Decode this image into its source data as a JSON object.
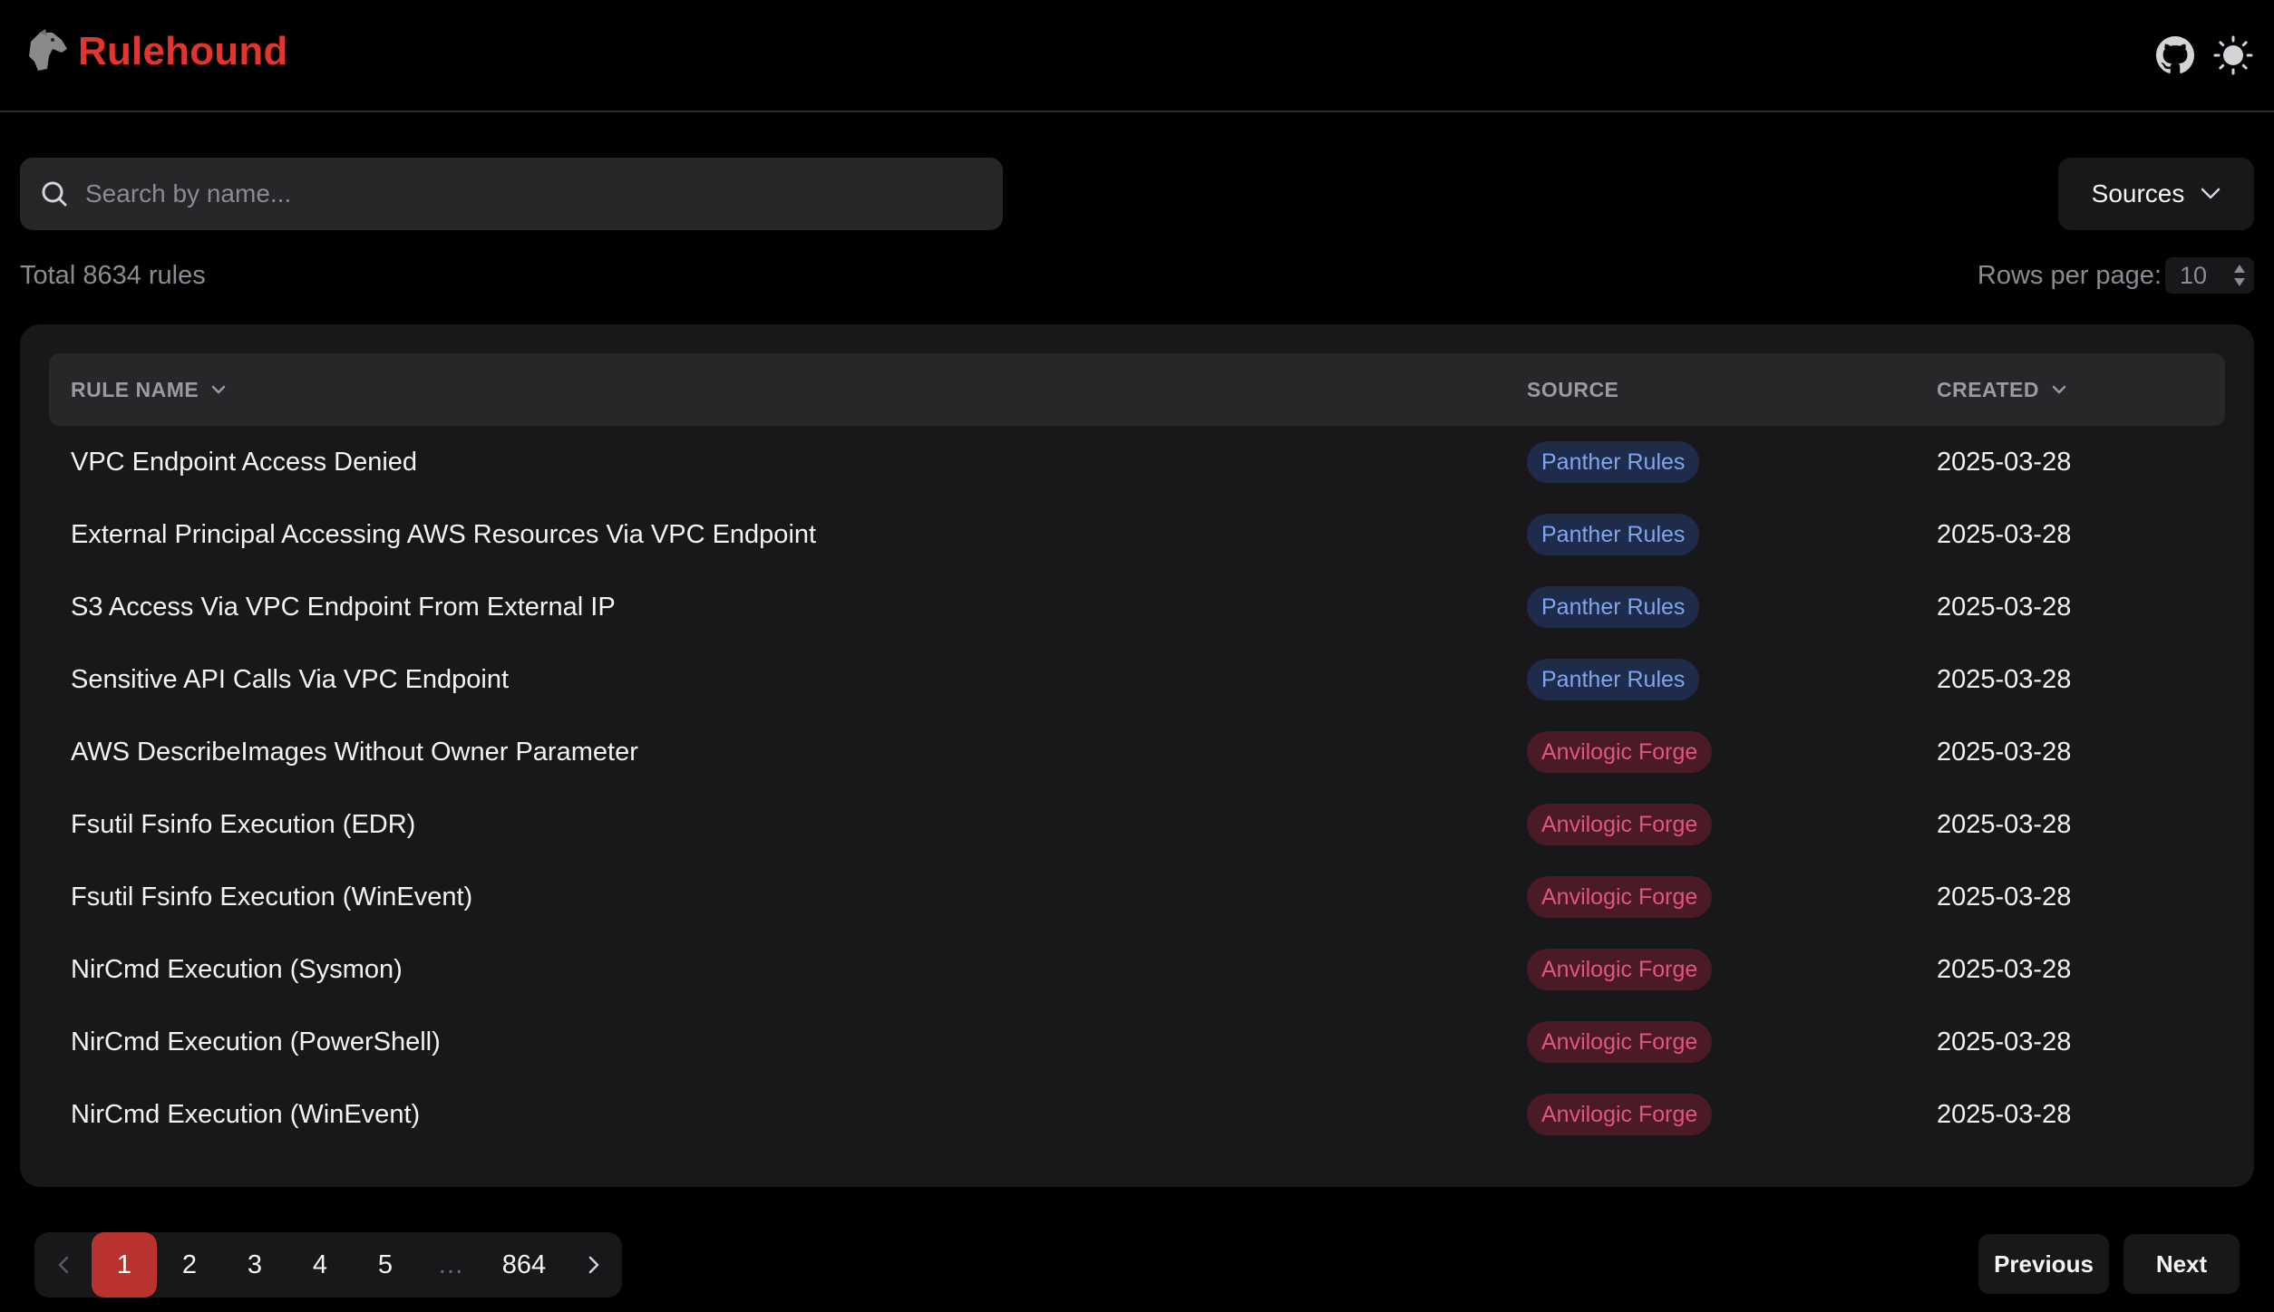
{
  "app": {
    "name": "Rulehound"
  },
  "header": {
    "icons": [
      "dog-logo-icon",
      "github-icon",
      "sun-icon"
    ]
  },
  "search": {
    "placeholder": "Search by name...",
    "value": ""
  },
  "sources_button": {
    "label": "Sources"
  },
  "summary": {
    "total_text": "Total 8634 rules",
    "rows_per_page_label": "Rows per page:",
    "rows_per_page_value": "10"
  },
  "table": {
    "headers": {
      "name": "RULE NAME",
      "source": "SOURCE",
      "created": "CREATED"
    },
    "rows": [
      {
        "name": "VPC Endpoint Access Denied",
        "source": "Panther Rules",
        "created": "2025-03-28"
      },
      {
        "name": "External Principal Accessing AWS Resources Via VPC Endpoint",
        "source": "Panther Rules",
        "created": "2025-03-28"
      },
      {
        "name": "S3 Access Via VPC Endpoint From External IP",
        "source": "Panther Rules",
        "created": "2025-03-28"
      },
      {
        "name": "Sensitive API Calls Via VPC Endpoint",
        "source": "Panther Rules",
        "created": "2025-03-28"
      },
      {
        "name": "AWS DescribeImages Without Owner Parameter",
        "source": "Anvilogic Forge",
        "created": "2025-03-28"
      },
      {
        "name": "Fsutil Fsinfo Execution (EDR)",
        "source": "Anvilogic Forge",
        "created": "2025-03-28"
      },
      {
        "name": "Fsutil Fsinfo Execution (WinEvent)",
        "source": "Anvilogic Forge",
        "created": "2025-03-28"
      },
      {
        "name": "NirCmd Execution (Sysmon)",
        "source": "Anvilogic Forge",
        "created": "2025-03-28"
      },
      {
        "name": "NirCmd Execution (PowerShell)",
        "source": "Anvilogic Forge",
        "created": "2025-03-28"
      },
      {
        "name": "NirCmd Execution (WinEvent)",
        "source": "Anvilogic Forge",
        "created": "2025-03-28"
      }
    ]
  },
  "pagination": {
    "pages": [
      "1",
      "2",
      "3",
      "4",
      "5",
      "…",
      "864"
    ],
    "current": "1",
    "previous_label": "Previous",
    "next_label": "Next"
  },
  "colors": {
    "brand": "#e5342d",
    "panther_chip_bg": "#1e2b4a",
    "panther_chip_text": "#7ea6ef",
    "anvilogic_chip_bg": "#4a1a26",
    "anvilogic_chip_text": "#e0577a",
    "active_page": "#b8332d"
  }
}
